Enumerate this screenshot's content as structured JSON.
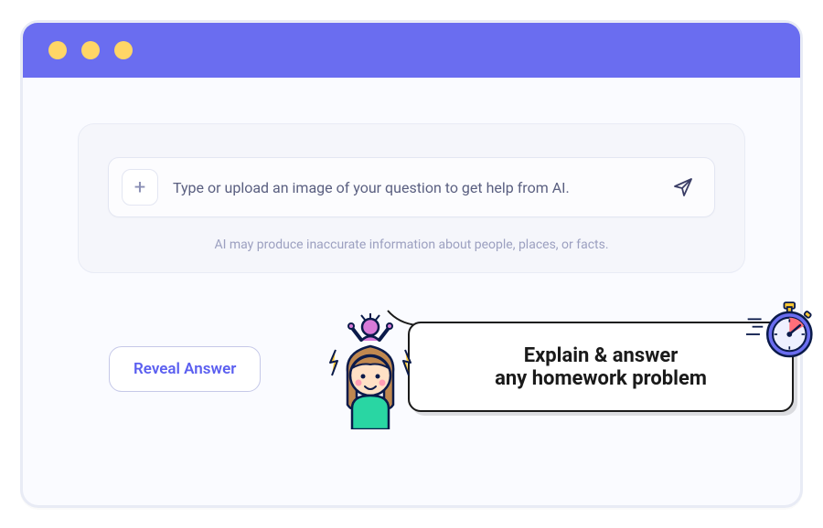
{
  "input": {
    "placeholder": "Type or upload an image of your question to get help from AI."
  },
  "disclaimer": "AI may produce inaccurate information about people, places, or facts.",
  "reveal_button_label": "Reveal Answer",
  "callout": {
    "line1": "Explain & answer",
    "line2": "any homework problem"
  }
}
